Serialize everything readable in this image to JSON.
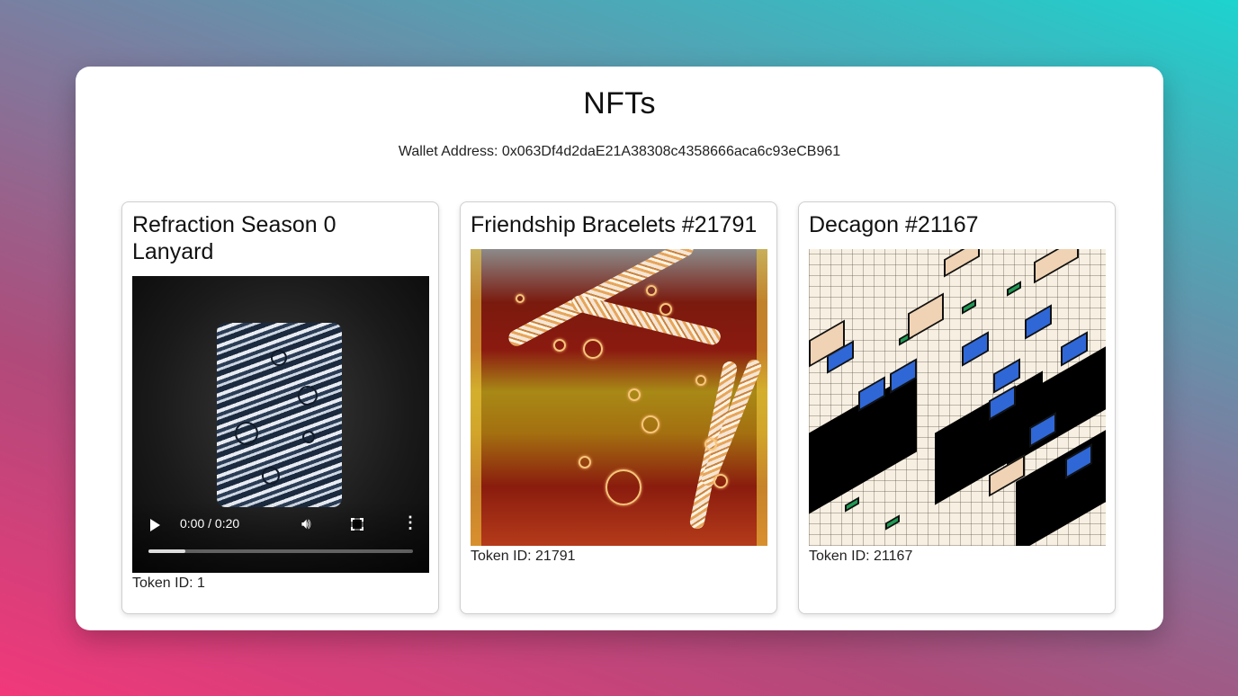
{
  "page": {
    "title": "NFTs",
    "wallet_label": "Wallet Address: 0x063Df4d2daE21A38308c4358666aca6c93eCB961"
  },
  "cards": [
    {
      "title": "Refraction Season 0 Lanyard",
      "media_type": "video",
      "video": {
        "time": "0:00 / 0:20",
        "progress": 0.14
      },
      "token_label": "Token ID: 1"
    },
    {
      "title": "Friendship Bracelets #21791",
      "media_type": "image",
      "token_label": "Token ID: 21791"
    },
    {
      "title": "Decagon #21167",
      "media_type": "image",
      "token_label": "Token ID: 21167"
    }
  ],
  "icons": {
    "play": "play-icon",
    "volume": "volume-icon",
    "fullscreen": "fullscreen-icon",
    "more": "more-vert-icon"
  },
  "colors": {
    "decagon_blue": "#2f67d6",
    "decagon_green": "#1f9a54",
    "decagon_tan": "#f0d3b4",
    "decagon_black": "#000000"
  }
}
